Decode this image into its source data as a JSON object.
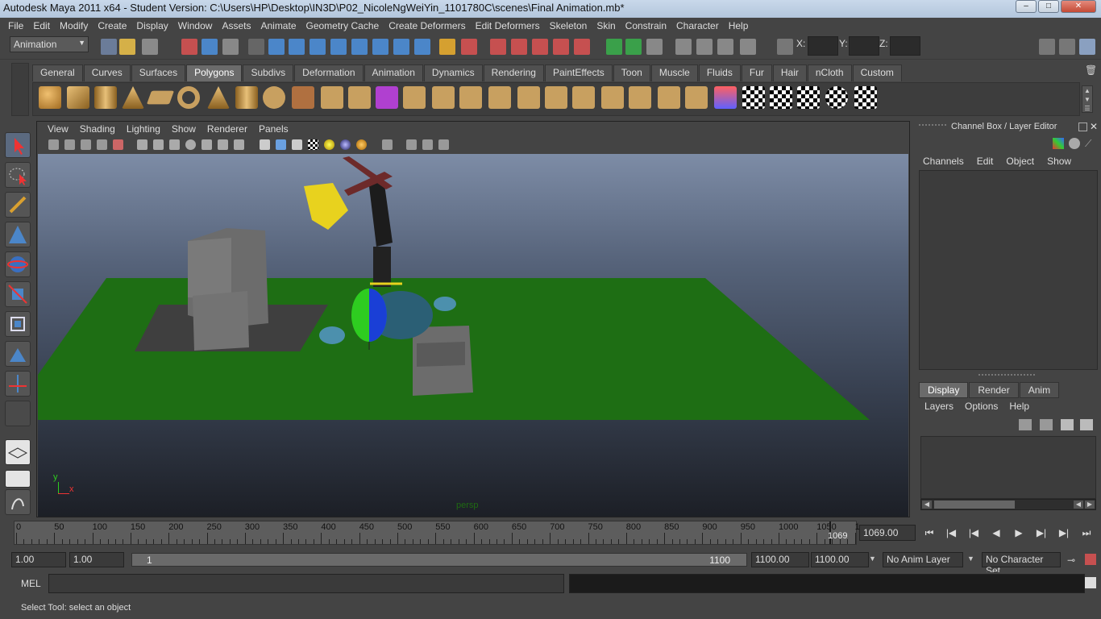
{
  "window": {
    "title": "Autodesk Maya 2011 x64 - Student Version: C:\\Users\\HP\\Desktop\\IN3D\\P02_NicoleNgWeiYin_1101780C\\scenes\\Final Animation.mb*"
  },
  "menubar": [
    "File",
    "Edit",
    "Modify",
    "Create",
    "Display",
    "Window",
    "Assets",
    "Animate",
    "Geometry Cache",
    "Create Deformers",
    "Edit Deformers",
    "Skeleton",
    "Skin",
    "Constrain",
    "Character",
    "Help"
  ],
  "status_line": {
    "mode": "Animation",
    "x_label": "X:",
    "y_label": "Y:",
    "z_label": "Z:"
  },
  "shelf_tabs": [
    "General",
    "Curves",
    "Surfaces",
    "Polygons",
    "Subdivs",
    "Deformation",
    "Animation",
    "Dynamics",
    "Rendering",
    "PaintEffects",
    "Toon",
    "Muscle",
    "Fluids",
    "Fur",
    "Hair",
    "nCloth",
    "Custom"
  ],
  "active_shelf": "Polygons",
  "viewport": {
    "menus": [
      "View",
      "Shading",
      "Lighting",
      "Show",
      "Renderer",
      "Panels"
    ],
    "camera": "persp",
    "axis_y": "y",
    "axis_x": "x"
  },
  "channel_box": {
    "title": "Channel Box / Layer Editor",
    "menus": [
      "Channels",
      "Edit",
      "Object",
      "Show"
    ]
  },
  "layer_editor": {
    "tabs": [
      "Display",
      "Render",
      "Anim"
    ],
    "active_tab": "Display",
    "menus": [
      "Layers",
      "Options",
      "Help"
    ]
  },
  "timeline": {
    "ticks": [
      "0",
      "50",
      "100",
      "150",
      "200",
      "250",
      "300",
      "350",
      "400",
      "450",
      "500",
      "550",
      "600",
      "650",
      "700",
      "750",
      "800",
      "850",
      "900",
      "950",
      "1000",
      "1050",
      "1"
    ],
    "current_frame_marker": "1069",
    "current_frame": "1069.00"
  },
  "range": {
    "start": "1.00",
    "anim_start": "1.00",
    "slider_start": "1",
    "slider_end": "1100",
    "anim_end": "1100.00",
    "end": "1100.00",
    "anim_layer": "No Anim Layer",
    "char_set": "No Character Set"
  },
  "command_line": {
    "label": "MEL"
  },
  "help_line": "Select Tool: select an object",
  "colors": {
    "ground": "#1e6e14",
    "sky_top": "#7d8ca6",
    "accent_yellow": "#e8d21e",
    "sphere_green": "#2ecc20",
    "sphere_blue": "#1a3fd6"
  }
}
